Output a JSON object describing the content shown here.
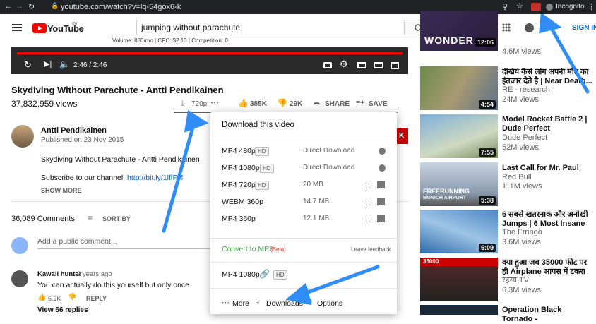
{
  "browser": {
    "url": "youtube.com/watch?v=lq-54gox6-k",
    "profile": "Incognito"
  },
  "header": {
    "logo": "YouTube",
    "region": "IN",
    "search_value": "jumping without parachute",
    "signin": "SIGN IN"
  },
  "seo_bar": "Volume: 880/mo | CPC: $2.13 | Competition: 0",
  "player": {
    "time": "2:46 / 2:46"
  },
  "video": {
    "title": "Skydiving Without Parachute - Antti Pendikainen",
    "views": "37,832,959 views",
    "quality_btn": "720p",
    "likes": "385K",
    "dislikes": "29K",
    "share": "SHARE",
    "save": "SAVE"
  },
  "channel": {
    "name": "Antti Pendikainen",
    "published": "Published on 23 Nov 2015",
    "desc1": "Skydiving Without Parachute - Antti Pendikainen",
    "desc2_prefix": "Subscribe to our channel: ",
    "desc2_link": "http://bit.ly/1lffPl4",
    "show_more": "SHOW MORE",
    "subscribe_fragment": "K"
  },
  "comments": {
    "count": "36,089 Comments",
    "sort": "SORT BY",
    "placeholder": "Add a public comment...",
    "items": [
      {
        "author": "Kawaii hunter",
        "time": "2 years ago",
        "text": "You can actually do this yourself but only once",
        "likes": "6.2K",
        "reply": "REPLY",
        "view_replies": "View 66 replies"
      }
    ]
  },
  "download_popup": {
    "title": "Download this video",
    "formats": [
      {
        "name": "MP4 480p",
        "badge": "HD",
        "info": "Direct Download"
      },
      {
        "name": "MP4 1080p",
        "badge": "HD",
        "info": "Direct Download"
      },
      {
        "name": "MP4 720p",
        "badge": "HD",
        "info": "20 MB"
      },
      {
        "name": "WEBM 360p",
        "badge": "",
        "info": "14.7 MB"
      },
      {
        "name": "MP4 360p",
        "badge": "",
        "info": "12.1 MB"
      }
    ],
    "convert": "Convert to MP3",
    "convert_tag": "(Beta)",
    "feedback": "Leave feedback",
    "pinned": {
      "name": "MP4 1080p",
      "badge": "HD"
    },
    "footer": {
      "more": "More",
      "downloads": "Downloads",
      "options": "Options"
    }
  },
  "sidebar": {
    "items": [
      {
        "title": "",
        "channel": "",
        "views": "4.6M views",
        "duration": "",
        "thumb_text": ""
      },
      {
        "title": "देखिये कैसे लोग अपनी मौत का इंतजार देते है | Near Death...",
        "channel": "RE - research",
        "views": "24M views",
        "duration": "4:54",
        "thumb_text": ""
      },
      {
        "title": "Model Rocket Battle 2 | Dude Perfect",
        "channel": "Dude Perfect",
        "views": "52M views",
        "duration": "7:55",
        "thumb_text": ""
      },
      {
        "title": "Last Call for Mr. Paul",
        "channel": "Red Bull",
        "views": "111M views",
        "duration": "5:38",
        "thumb_text": "FREERUNNING"
      },
      {
        "title": "6 सबसे खतरनाक और अनोखी Jumps | 6 Most Insane And...",
        "channel": "The Frringo",
        "views": "3.6M views",
        "duration": "6:09",
        "thumb_text": ""
      },
      {
        "title": "क्या हुआ जब 35000 फीट पर ही Airplane आपस में टकरा गए?",
        "channel": "रहस्य TV",
        "views": "6.3M views",
        "duration": "",
        "thumb_text": "35000"
      },
      {
        "title": "Operation Black Tornado -",
        "channel": "",
        "views": "",
        "duration": "",
        "thumb_text": ""
      }
    ],
    "top_duration": "12:06",
    "top_thumb_text": "WONDER",
    "airport_text": "MUNICH AIRPORT"
  }
}
